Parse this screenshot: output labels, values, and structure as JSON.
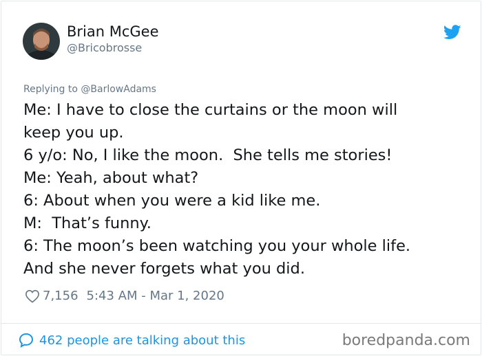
{
  "user": {
    "name": "Brian McGee",
    "handle": "@Bricobrosse"
  },
  "tweet": {
    "replying_prefix": "Replying to ",
    "replying_to": "@BarlowAdams",
    "lines": [
      "Me: I have to close the curtains or the moon will",
      "keep you up.",
      "6 y/o: No, I like the moon.  She tells me stories!",
      "Me: Yeah, about what?",
      "6: About when you were a kid like me.",
      "M:  That’s funny.",
      "6: The moon’s been watching you your whole life.",
      "And she never forgets what you did."
    ],
    "likes": "7,156",
    "timestamp": "5:43 AM - Mar 1, 2020"
  },
  "footer": {
    "talking": "462 people are talking about this",
    "watermark": "boredpanda.com"
  },
  "icons": {
    "platform": "twitter-bird-icon",
    "like": "heart-icon",
    "conversation": "speech-bubble-icon"
  },
  "colors": {
    "accent": "#1da1f2",
    "link": "#1b95e0",
    "muted": "#657786",
    "text": "#14171a"
  }
}
